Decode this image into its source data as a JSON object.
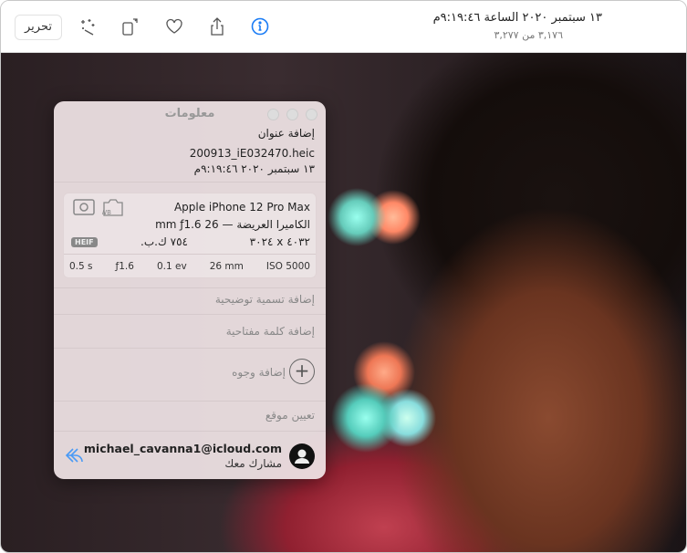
{
  "toolbar": {
    "edit_label": "تحرير",
    "title": "١٣ سبتمبر ٢٠٢٠ الساعة ٩:١٩:٤٦م",
    "subtitle": "٣,١٧٦ من ٣,٢٧٧"
  },
  "info": {
    "window_title": "معلومات",
    "add_title": "إضافة عنوان",
    "filename": "200913_iE032470.heic",
    "date": "١٣ سبتمبر ٢٠٢٠   ٩:١٩:٤٦م",
    "camera": {
      "device": "Apple iPhone  12 Pro Max",
      "lens": "الكاميرا العريضة — 26 mm  ƒ1.6",
      "dimensions": "٤٠٣٢ x ٣٠٢٤",
      "size": "٧٥٤ ك.ب.",
      "format": "HEIF",
      "exif": [
        "0.5 s",
        "ƒ1.6",
        "0.1 ev",
        "26 mm",
        "ISO 5000"
      ]
    },
    "add_caption": "إضافة تسمية توضيحية",
    "add_keyword": "إضافة كلمة مفتاحية",
    "add_faces": "إضافة وجوه",
    "assign_location": "تعيين موقع",
    "shared_by": "michael_cavanna1@icloud.com",
    "shared_with_you": "مشارك معك"
  },
  "colors": {
    "accent": "#1a7cf5"
  }
}
